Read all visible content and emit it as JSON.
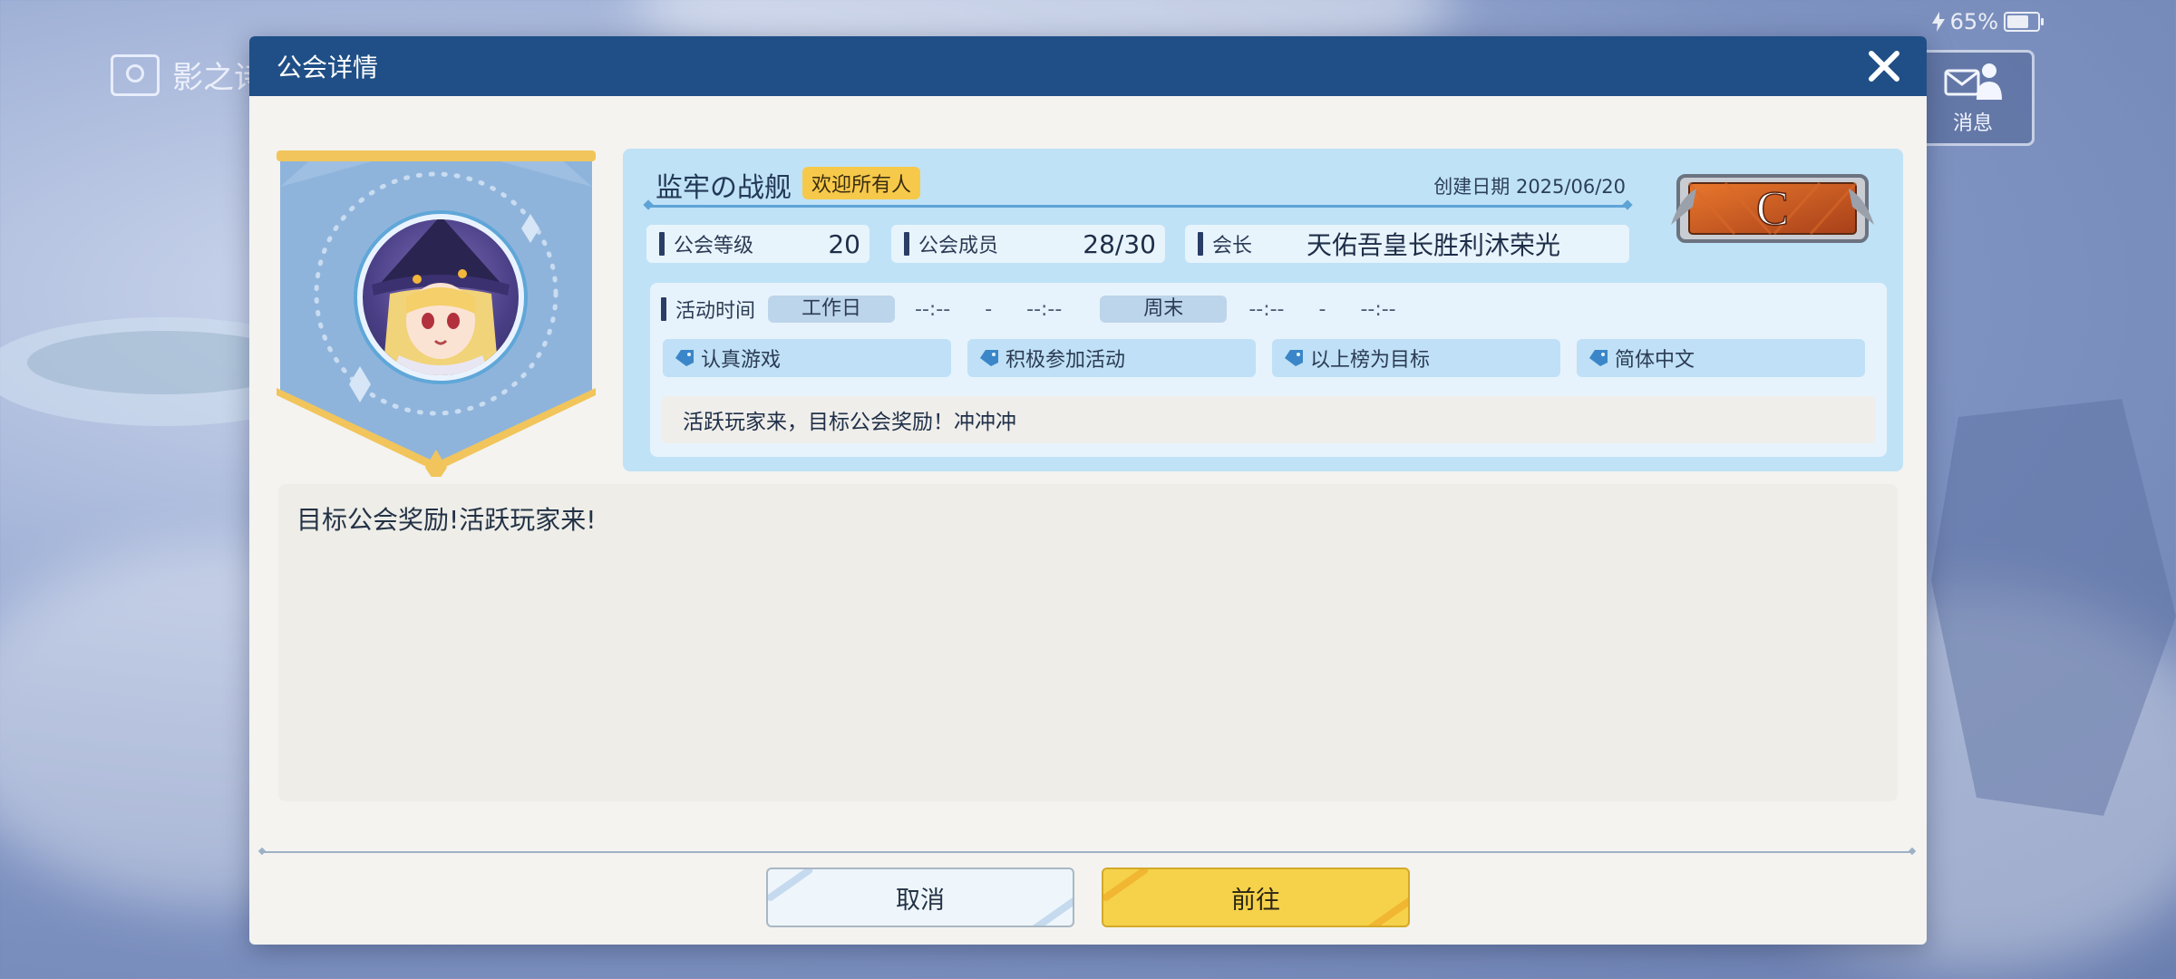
{
  "background": {
    "game_title": "影之诗"
  },
  "status_bar": {
    "battery_percent": "65%",
    "battery_level": 0.65
  },
  "message_button": {
    "label": "消息",
    "icon": "mail-person-icon"
  },
  "modal": {
    "title": "公会详情",
    "close_icon": "close-icon",
    "guild": {
      "name": "监牢の战舰",
      "badge": "欢迎所有人",
      "created_label": "创建日期",
      "created_date": "2025/06/20",
      "rank": "C",
      "stats": [
        {
          "label": "公会等级",
          "value": "20"
        },
        {
          "label": "公会成员",
          "value": "28/30"
        },
        {
          "label": "会长",
          "value": "天佑吾皇长胜利沐荣光"
        }
      ]
    },
    "activity": {
      "label": "活动时间",
      "weekday_label": "工作日",
      "weekday_start": "--:--",
      "weekday_sep": "-",
      "weekday_end": "--:--",
      "weekend_label": "周末",
      "weekend_start": "--:--",
      "weekend_sep": "-",
      "weekend_end": "--:--"
    },
    "tags": [
      "认真游戏",
      "积极参加活动",
      "以上榜为目标",
      "简体中文"
    ],
    "description": "活跃玩家来，目标公会奖励！冲冲冲",
    "notice": "目标公会奖励!活跃玩家来!",
    "buttons": {
      "cancel": "取消",
      "go": "前往"
    }
  },
  "colors": {
    "header": "#1f4f86",
    "panel": "#bfe2f7",
    "accent_yellow": "#f6d24a",
    "badge_yellow": "#f6c94a",
    "rank_orange": "#c8561c"
  }
}
